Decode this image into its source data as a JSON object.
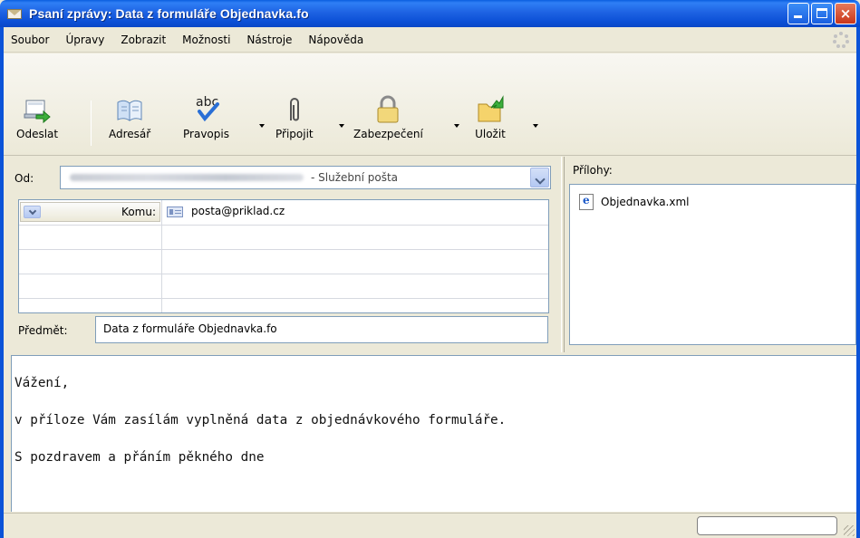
{
  "window": {
    "title": "Psaní zprávy: Data z formuláře Objednavka.fo",
    "controls": {
      "minimize": "minimize-icon",
      "maximize": "maximize-icon",
      "close": "×"
    }
  },
  "menu": [
    "Soubor",
    "Úpravy",
    "Zobrazit",
    "Možnosti",
    "Nástroje",
    "Nápověda"
  ],
  "toolbar": {
    "send": "Odeslat",
    "addressbook": "Adresář",
    "spelling": "Pravopis",
    "spelling_glyph": "abc",
    "attach": "Připojit",
    "security": "Zabezpečení",
    "save": "Uložit"
  },
  "header": {
    "from_label": "Od:",
    "from_account": "- Služební pošta",
    "recipient_type": "Komu:",
    "recipient": "posta@priklad.cz",
    "subject_label": "Předmět:",
    "subject": "Data z formuláře Objednavka.fo"
  },
  "attachments": {
    "label": "Přílohy:",
    "items": [
      "Objednavka.xml"
    ]
  },
  "body": [
    "Vážení,",
    "v příloze Vám zasílám vyplněná data z objednávkového formuláře.",
    "S pozdravem a přáním pěkného dne"
  ],
  "colors": {
    "titlebar": "#0b4fd6",
    "window_bg": "#ece9d8",
    "field_border": "#7f9db9",
    "close_button": "#c9361a"
  }
}
